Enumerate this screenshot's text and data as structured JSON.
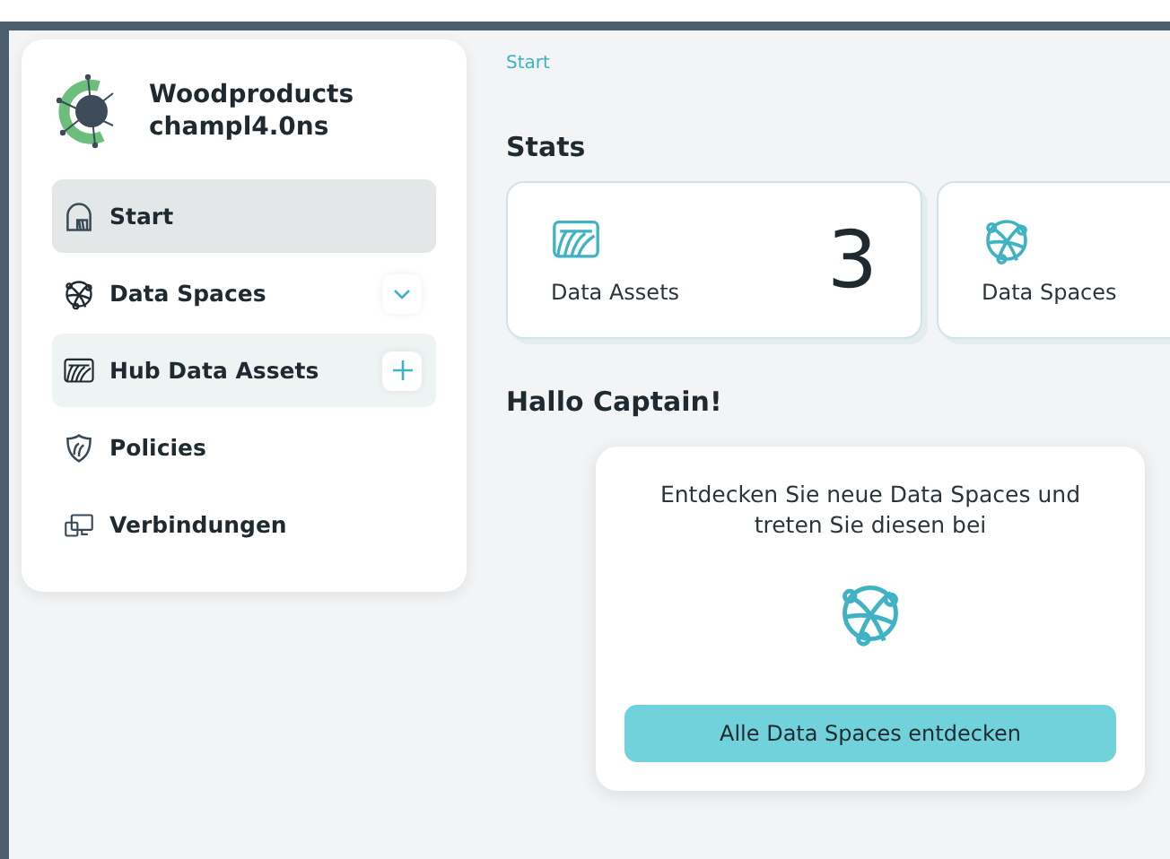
{
  "brand": {
    "line1": "Woodproducts",
    "line2": "champl4.0ns"
  },
  "nav": [
    {
      "label": "Start",
      "kind": "plain",
      "selected": true,
      "highlighted": false
    },
    {
      "label": "Data Spaces",
      "kind": "expand",
      "selected": false,
      "highlighted": false
    },
    {
      "label": "Hub Data Assets",
      "kind": "add",
      "selected": false,
      "highlighted": true
    },
    {
      "label": "Policies",
      "kind": "plain",
      "selected": false,
      "highlighted": false
    },
    {
      "label": "Verbindungen",
      "kind": "plain",
      "selected": false,
      "highlighted": false
    }
  ],
  "breadcrumb": "Start",
  "stats_title": "Stats",
  "stats": [
    {
      "label": "Data Assets",
      "value": "3"
    },
    {
      "label": "Data Spaces"
    }
  ],
  "greeting": "Hallo Captain!",
  "welcome": {
    "text": "Entdecken Sie neue Data Spaces und treten Sie diesen bei",
    "button": "Alle Data Spaces entdecken"
  }
}
